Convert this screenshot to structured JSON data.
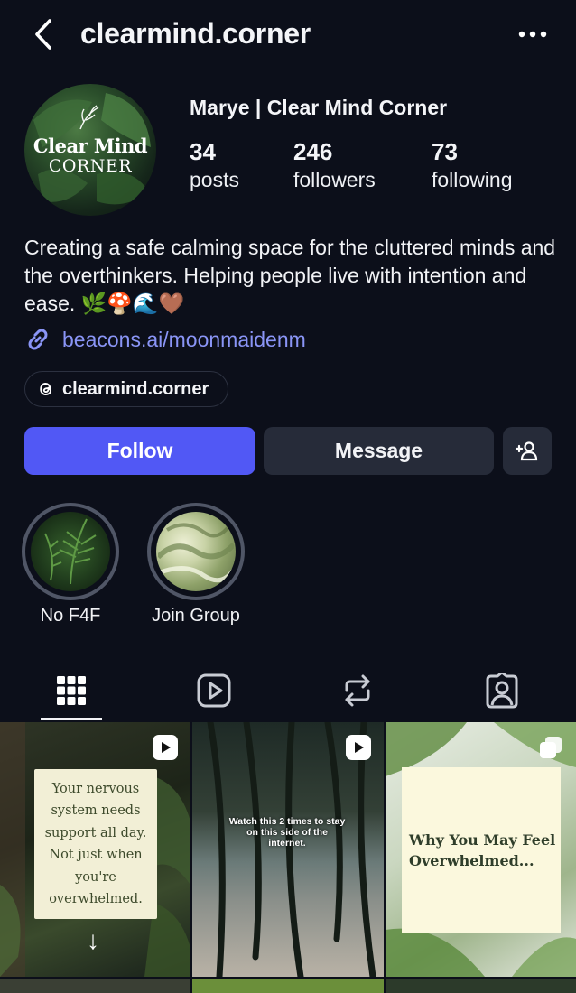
{
  "header": {
    "username": "clearmind.corner",
    "back_icon": "chevron-left-icon",
    "more_icon": "more-horizontal-icon"
  },
  "profile": {
    "avatar_text_line1": "Clear Mind",
    "avatar_text_line2": "CORNER",
    "display_name": "Marye | Clear Mind Corner",
    "stats": [
      {
        "value": "34",
        "label": "posts"
      },
      {
        "value": "246",
        "label": "followers"
      },
      {
        "value": "73",
        "label": "following"
      }
    ],
    "bio": "Creating a safe calming space for the cluttered minds and the overthinkers. Helping people live with intention and ease. 🌿🍄🌊🤎",
    "link": "beacons.ai/moonmaidenm",
    "threads_handle": "clearmind.corner"
  },
  "actions": {
    "follow_label": "Follow",
    "message_label": "Message",
    "add_user_icon": "add-user-icon"
  },
  "highlights": [
    {
      "label": "No F4F"
    },
    {
      "label": "Join Group"
    }
  ],
  "tabs": [
    {
      "name": "grid",
      "icon": "grid-icon",
      "active": true
    },
    {
      "name": "reels",
      "icon": "reels-icon",
      "active": false
    },
    {
      "name": "reposts",
      "icon": "repost-icon",
      "active": false
    },
    {
      "name": "tagged",
      "icon": "tagged-icon",
      "active": false
    }
  ],
  "posts": [
    {
      "type": "reel",
      "text": "Your nervous system needs support all day. Not just when you're overwhelmed.",
      "arrow": "↓"
    },
    {
      "type": "reel",
      "text": "Watch this 2 times to stay on this side of the internet."
    },
    {
      "type": "carousel",
      "text": "Why You May Feel Overwhelmed..."
    }
  ],
  "colors": {
    "background": "#0c0f1a",
    "accent": "#5158f5",
    "link": "#8a95f6",
    "secondary_button": "#262b39"
  }
}
